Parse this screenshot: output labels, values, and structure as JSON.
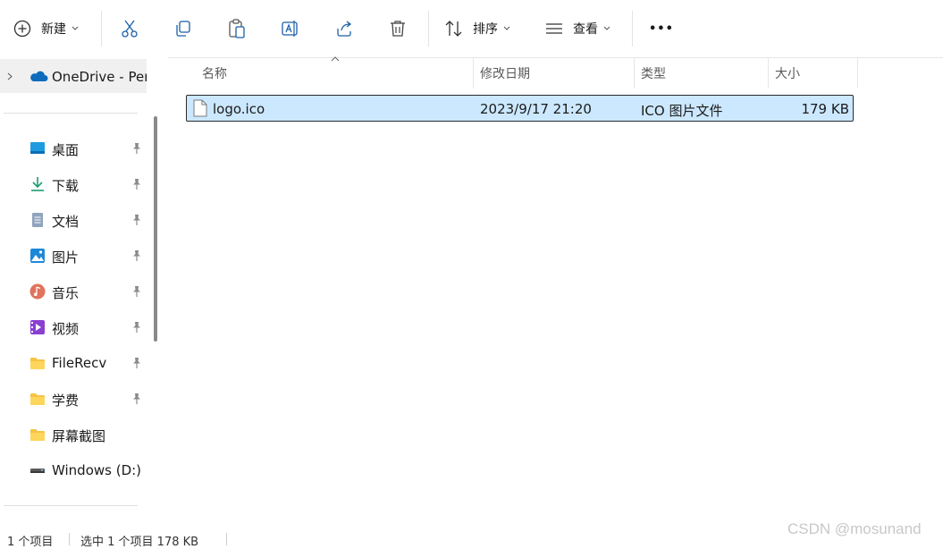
{
  "toolbar": {
    "new_label": "新建",
    "sort_label": "排序",
    "view_label": "查看",
    "more_label": "•••"
  },
  "sidebar": {
    "onedrive_label": "OneDrive - Per",
    "items": [
      {
        "label": "桌面",
        "icon": "desktop-icon",
        "pinned": true
      },
      {
        "label": "下载",
        "icon": "download-icon",
        "pinned": true
      },
      {
        "label": "文档",
        "icon": "document-icon",
        "pinned": true
      },
      {
        "label": "图片",
        "icon": "pictures-icon",
        "pinned": true
      },
      {
        "label": "音乐",
        "icon": "music-icon",
        "pinned": true
      },
      {
        "label": "视频",
        "icon": "video-icon",
        "pinned": true
      },
      {
        "label": "FileRecv",
        "icon": "folder-icon",
        "pinned": true
      },
      {
        "label": "学费",
        "icon": "folder-icon",
        "pinned": true
      },
      {
        "label": "屏幕截图",
        "icon": "folder-icon",
        "pinned": false
      },
      {
        "label": "Windows (D:)",
        "icon": "drive-icon",
        "pinned": false
      }
    ]
  },
  "columns": {
    "name": "名称",
    "modified": "修改日期",
    "type": "类型",
    "size": "大小"
  },
  "files": [
    {
      "name": "logo.ico",
      "modified": "2023/9/17 21:20",
      "type": "ICO 图片文件",
      "size": "179 KB",
      "selected": true
    }
  ],
  "status": {
    "count": "1 个项目",
    "selection": "选中 1 个项目  178 KB"
  },
  "watermark": "CSDN @mosunand",
  "colors": {
    "accent": "#0067c0",
    "selection_bg": "#cce8ff"
  }
}
